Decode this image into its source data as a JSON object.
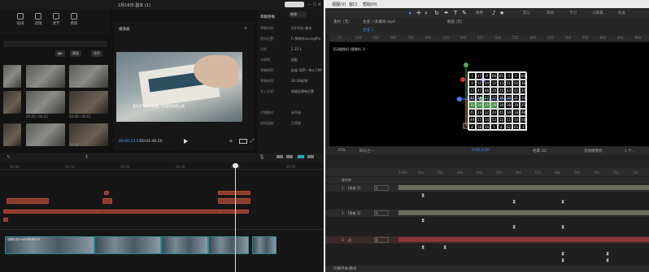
{
  "left": {
    "title": "2月16日-副本 (1)",
    "toolbar": [
      {
        "label": "贴纸",
        "icon": "sticker-icon"
      },
      {
        "label": "滤镜",
        "icon": "filter-icon"
      },
      {
        "label": "调节",
        "icon": "adjust-icon"
      },
      {
        "label": "模板",
        "icon": "template-icon"
      }
    ],
    "media_buttons": [
      "筛选",
      "排序"
    ],
    "thumbs": [
      {
        "label": "00:13 / 00:14"
      },
      {
        "label": "00:03 / 00:01"
      },
      {
        "label": "00:08 / 00:04"
      },
      {
        "label": "00:03 / 00:01"
      },
      {
        "label": "00:05 / 00:03"
      },
      {
        "label": "00:09 / 00:01"
      },
      {
        "label": "00:03"
      },
      {
        "label": "00:03 / 00:04"
      },
      {
        "label": "00:05"
      }
    ],
    "player": {
      "header": "播放器",
      "subtitle": "我的字写的不好看，但我写的很认真",
      "timecode": "00:00:23:07",
      "duration": "00:01:46:20"
    },
    "props": {
      "header": "草稿参数",
      "button": "修改",
      "rows": [
        {
          "k": "草稿名称:",
          "v": "2月16日-副本"
        },
        {
          "k": "保存位置:",
          "v": "F:/剪映/JianyingPro"
        },
        {
          "k": "比例:",
          "v": "2.35:1"
        },
        {
          "k": "分辨率:",
          "v": "适配"
        },
        {
          "k": "草稿帧率:",
          "v": "标准 SDR - Rec.709"
        },
        {
          "k": "草稿帧率:",
          "v": "30.00帧/秒"
        },
        {
          "k": "导入方式:",
          "v": "保留在原有位置"
        },
        {
          "k": "代理模式:",
          "v": "未开启"
        },
        {
          "k": "自由层级:",
          "v": "已开启"
        }
      ]
    },
    "timeline": {
      "ruler": [
        "00:00",
        "00:10",
        "00:20",
        "00:30",
        "00:40",
        "00:50"
      ],
      "video_label": "视频片段.mp4  00:00:00"
    }
  },
  "right": {
    "menu": [
      "视图(V)",
      "窗口",
      "帮助(H)"
    ],
    "tools": [
      "对齐",
      "♪",
      "★"
    ],
    "workspaces": [
      "默认",
      "审阅",
      "学习",
      "小屏幕",
      "标准"
    ],
    "tabs": {
      "source": "素材（无）",
      "comp_tab": "合成 八卦素材.mp4",
      "layer_tab": "图层 (无)",
      "breadcrumb1": "合成 1",
      "comp_name": "活动摄像机 (摄像机 1)"
    },
    "ruler": [
      "50",
      "100",
      "150",
      "200",
      "250",
      "300",
      "350",
      "400",
      "450",
      "500",
      "550",
      "600",
      "650",
      "700",
      "750",
      "800",
      "850",
      "900"
    ],
    "grid": [
      [
        "1",
        "17",
        "9",
        "60",
        "61",
        "3",
        "2",
        "64"
      ],
      [
        "9",
        "55",
        "54",
        "12",
        "13",
        "51",
        "50",
        "16"
      ],
      [
        "17",
        "47",
        "46",
        "20",
        "21",
        "43",
        "42",
        "24"
      ],
      [
        "40",
        "26",
        "27",
        "37",
        "36",
        "30",
        "31",
        "33"
      ],
      [
        "32",
        "34",
        "35",
        "29",
        "28",
        "38",
        "39",
        "25"
      ],
      [
        "41",
        "23",
        "22",
        "44",
        "45",
        "19",
        "18",
        "48"
      ],
      [
        "49",
        "15",
        "14",
        "52",
        "53",
        "11",
        "10",
        "56"
      ],
      [
        "8",
        "58",
        "59",
        "5",
        "4",
        "62",
        "63",
        "1"
      ]
    ],
    "status": {
      "zoom": "25%",
      "quality": "四分之一",
      "timecode": "0;00;0;00",
      "renderer": "经典 3D",
      "camera": "活动摄像机",
      "views": "1 个..."
    },
    "timeline": {
      "ruler": [
        "0:00s",
        "01s",
        "02s",
        "03s",
        "04s",
        "05s",
        "06s",
        "07s",
        "08s",
        "09s",
        "10s",
        "11s",
        "12s"
      ],
      "layers": [
        {
          "num": "1",
          "name": "[合成 1]",
          "mode": "无"
        },
        {
          "num": "2",
          "name": "[合成 1]",
          "mode": "无"
        },
        {
          "num": "3",
          "name": "点",
          "mode": "无"
        }
      ],
      "header": "源名称",
      "bottom": "切换开关/模式"
    }
  }
}
